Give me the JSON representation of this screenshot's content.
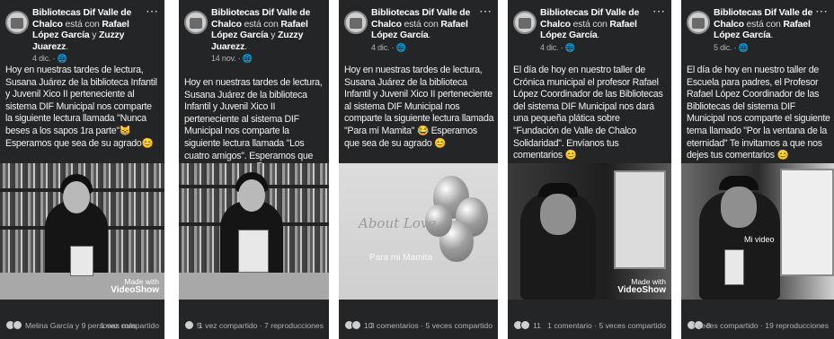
{
  "cards": [
    {
      "page": "Bibliotecas Dif Valle de Chalco",
      "with": "está con",
      "tagged": "Rafael López García",
      "and": "y",
      "tagged2": "Zuzzy Juarezz",
      "end": ".",
      "date": "4 dic. · ",
      "text": "Hoy en nuestras tardes de lectura, Susana Juárez de la biblioteca Infantil y Juvenil Xico II perteneciente al sistema DIF Municipal nos comparte la siguiente lectura llamada \"Nunca beses a los sapos 1ra parte\"😸 Esperamos que sea de su agrado😊",
      "reactions": "Melina García y 9 personas más",
      "stats": "1 vez compartido",
      "watermark": [
        "Made with",
        "VideoShow"
      ]
    },
    {
      "page": "Bibliotecas Dif Valle de Chalco",
      "with": "está con",
      "tagged": "Rafael López García",
      "and": "y",
      "tagged2": "Zuzzy Juarezz",
      "end": ".",
      "date": "14 nov. · ",
      "text": "Hoy en nuestras tardes de lectura, Susana Juárez de la biblioteca Infantil y Juvenil Xico II perteneciente al sistema DIF Municipal nos comparte la siguiente lectura llamada \"Los cuatro amigos\". Esperamos que sea de su agrado😊",
      "reactions": "5",
      "stats": "1 vez compartido · 7 reproducciones"
    },
    {
      "page": "Bibliotecas Dif Valle de Chalco",
      "with": "está con",
      "tagged": "Rafael López García",
      "end": ".",
      "date": "4 dic. · ",
      "text": "Hoy en nuestras tardes de lectura, Susana Juárez de la biblioteca Infantil y Juvenil Xico II perteneciente al sistema DIF Municipal nos comparte la siguiente lectura llamada \"Para mí Mamita\" 😂 Esperamos que sea de su agrado 😊",
      "reactions": "10",
      "stats": "3 comentarios · 5 veces compartido",
      "video_title": "About Love",
      "video_caption": "Para mi Mamita"
    },
    {
      "page": "Bibliotecas Dif Valle de Chalco",
      "with": "está con",
      "tagged": "Rafael López García",
      "end": ".",
      "date": "4 dic. · ",
      "text": "El día de hoy en nuestro taller de Crónica municipal el profesor Rafael López Coordinador de las Bibliotecas del sistema DIF Municipal nos dará una pequeña plática sobre \"Fundación de Valle de Chalco Solidaridad\". Envíanos tus comentarios 😊",
      "reactions": "11",
      "stats": "1 comentario · 5 veces compartido",
      "watermark": [
        "Made with",
        "VideoShow"
      ]
    },
    {
      "page": "Bibliotecas Dif Valle de Chalco",
      "with": "está con",
      "tagged": "Rafael López García",
      "end": ".",
      "date": "5 dic. · ",
      "text": "El día de hoy en nuestro taller de Escuela para padres, el Profesor Rafael López Coordinador de las Bibliotecas del sistema DIF Municipal nos comparte el siguiente tema llamado \"Por la ventana de la eternidad\" Te invitamos a que nos dejes tus comentarios 😊",
      "reactions": "8",
      "stats": "3 veces compartido · 19 reproducciones",
      "video_caption": "Mi video"
    }
  ],
  "icons": {
    "more": "⋯",
    "globe": "🌐",
    "reaction": "like-love-icons"
  }
}
